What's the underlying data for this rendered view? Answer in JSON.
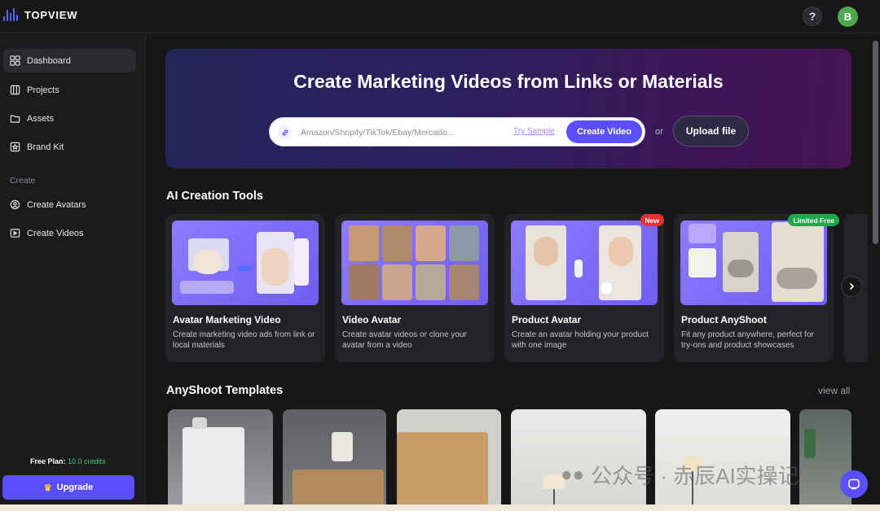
{
  "app": {
    "name": "TOPVIEW",
    "help_label": "?",
    "user_initial": "B"
  },
  "sidebar": {
    "items": [
      {
        "label": "Dashboard",
        "icon": "grid-icon",
        "active": true
      },
      {
        "label": "Projects",
        "icon": "projects-icon"
      },
      {
        "label": "Assets",
        "icon": "folder-icon"
      },
      {
        "label": "Brand Kit",
        "icon": "brand-kit-icon"
      }
    ],
    "section_label": "Create",
    "create_items": [
      {
        "label": "Create Avatars",
        "icon": "avatar-icon"
      },
      {
        "label": "Create Videos",
        "icon": "video-icon"
      }
    ],
    "plan_label": "Free Plan:",
    "credits": "10.0 credits",
    "upgrade_label": "Upgrade"
  },
  "hero": {
    "title": "Create Marketing Videos from Links or Materials",
    "placeholder": "Amazon/Shopify/TikTok/Ebay/Mercado...",
    "try_sample": "Try Sample",
    "create_button": "Create Video",
    "or": "or",
    "upload_button": "Upload file"
  },
  "ai_tools": {
    "title": "AI Creation Tools",
    "cards": [
      {
        "title": "Avatar Marketing Video",
        "description": "Create marketing video ads from link or local materials"
      },
      {
        "title": "Video Avatar",
        "description": "Create avatar videos or clone your avatar from a video"
      },
      {
        "title": "Product Avatar",
        "description": "Create an avatar holding your product with one image",
        "badge": "New"
      },
      {
        "title": "Product AnyShoot",
        "description": "Fit any product anywhere, perfect for try-ons and product showcases",
        "badge": "Limited Free"
      }
    ]
  },
  "templates": {
    "title": "AnyShoot Templates",
    "view_all": "view all"
  },
  "watermark": "公众号 · 赤辰AI实操记",
  "colors": {
    "accent": "#5a4fff",
    "credits": "#3ed07a",
    "new_badge": "#e53232",
    "free_badge": "#1fa84a"
  }
}
